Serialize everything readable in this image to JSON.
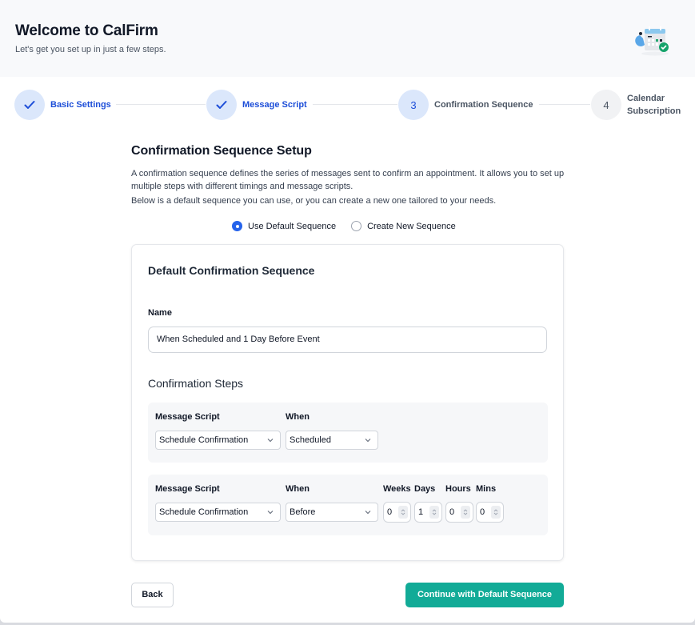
{
  "header": {
    "title": "Welcome to CalFirm",
    "subtitle": "Let's get you set up in just a few steps.",
    "illustration": "calendar-check-illustration"
  },
  "stepper": {
    "steps": [
      {
        "number": "1",
        "label": "Basic Settings",
        "status": "done",
        "icon": "check-icon"
      },
      {
        "number": "2",
        "label": "Message Script",
        "status": "done",
        "icon": "check-icon"
      },
      {
        "number": "3",
        "label": "Confirmation Sequence",
        "status": "current"
      },
      {
        "number": "4",
        "label_line1": "Calendar",
        "label_line2": "Subscription",
        "status": "pending"
      }
    ]
  },
  "setup": {
    "title": "Confirmation Sequence Setup",
    "description1": "A confirmation sequence defines the series of messages sent to confirm an appointment. It allows you to set up multiple steps with different timings and message scripts.",
    "description2": "Below is a default sequence you can use, or you can create a new one tailored to your needs.",
    "options": [
      {
        "label": "Use Default Sequence",
        "checked": true
      },
      {
        "label": "Create New Sequence",
        "checked": false
      }
    ]
  },
  "card": {
    "title": "Default Confirmation Sequence",
    "name_label": "Name",
    "name_value": "When Scheduled and 1 Day Before Event",
    "steps_title": "Confirmation Steps",
    "steps": [
      {
        "message_script_label": "Message Script",
        "message_script_value": "Schedule Confirmation",
        "when_label": "When",
        "when_value": "Scheduled"
      },
      {
        "message_script_label": "Message Script",
        "message_script_value": "Schedule Confirmation",
        "when_label": "When",
        "when_value": "Before",
        "weeks_label": "Weeks",
        "weeks_value": "0",
        "days_label": "Days",
        "days_value": "1",
        "hours_label": "Hours",
        "hours_value": "0",
        "mins_label": "Mins",
        "mins_value": "0"
      }
    ]
  },
  "footer": {
    "back_label": "Back",
    "continue_label": "Continue with Default Sequence"
  },
  "colors": {
    "accent_blue": "#1d4ed8",
    "step_circle_bg": "#dbe7fb",
    "primary_button": "#12ab97",
    "radio_checked": "#2563eb"
  }
}
